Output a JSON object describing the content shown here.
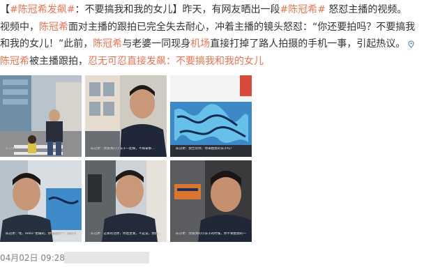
{
  "post": {
    "line1": {
      "bracket_open": "【",
      "tag": "#陈冠希发飙#",
      "rest": "：不要搞我和我的女儿】昨天，有网友晒出一段",
      "tag2": "#陈冠希#",
      "tail": " 怒怼主播的视频。"
    },
    "line2": {
      "a": "视频中，",
      "link": "陈冠希",
      "b": "面对主播的跟拍已完全失去耐心，冲着主播的镜头怒怼：“你还要拍吗？不要搞我"
    },
    "line3": {
      "a": "和我的女儿！”此前，",
      "link1": "陈冠希",
      "b": "与老婆一同现身",
      "link2": "机场",
      "c": "直接打掉了路人拍摄的手机一事，引起热议。",
      "pin_icon": "map-pin-icon"
    },
    "line4": {
      "link1": "陈冠希",
      "a": "被主播跟拍，",
      "link2": "忍无可忍直接发飙：不要搞我和我的女儿"
    }
  },
  "photos": [
    {
      "caption": "陈冠希：…"
    },
    {
      "caption": "陈冠希：我跟我的小孩子一起啊，不如拿那…"
    },
    {
      "caption": "陈冠希：我告诉你，你来拍我的孩子吗？"
    },
    {
      "caption": "陈冠希：嘿，Hello! 拍摄的，你拍我的一，拍什么拍，我在上面要拍…"
    },
    {
      "caption": "陈冠希：这样的话你，你连坐我，不是说，我们…"
    },
    {
      "caption": "陈冠希：我跟我的小孩子的时候，你不要拍我的一…"
    }
  ],
  "meta": {
    "timestamp": "04月02日 09:28"
  },
  "colors": {
    "link": "#eb7350",
    "text": "#333333",
    "meta": "#808080"
  }
}
